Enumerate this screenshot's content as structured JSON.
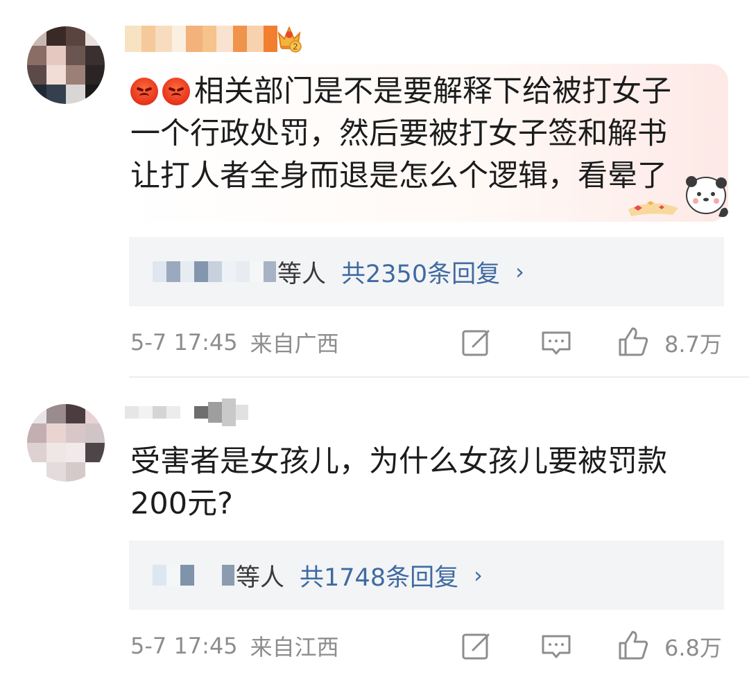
{
  "comments": [
    {
      "text_lines": [
        "相关部门是不是要解释下给被打女子",
        "一个行政处罚，然后要被打女子签和解书",
        "让打人者全身而退是怎么个逻辑，看晕了"
      ],
      "reply_suffix": "等人",
      "reply_count": "共2350条回复",
      "reply_chevron": "›",
      "date": "5-7 17:45",
      "location": "来自广西",
      "likes": "8.7万",
      "icons": [
        "angry-face-icon",
        "crown-badge-icon",
        "sticker-icon",
        "edit-icon",
        "comment-icon",
        "thumbs-up-icon",
        "chevron-right-icon"
      ]
    },
    {
      "text_lines": [
        "受害者是女孩儿，为什么女孩儿要被罚款",
        "200元?"
      ],
      "reply_suffix": "等人",
      "reply_count": "共1748条回复",
      "reply_chevron": "›",
      "date": "5-7 17:45",
      "location": "来自江西",
      "likes": "6.8万",
      "icons": [
        "edit-icon",
        "comment-icon",
        "thumbs-up-icon",
        "chevron-right-icon"
      ]
    }
  ],
  "colors": {
    "link_blue": "#3f6aa1",
    "meta_gray": "#8d8d8d",
    "reply_bg": "#f3f4f6"
  }
}
